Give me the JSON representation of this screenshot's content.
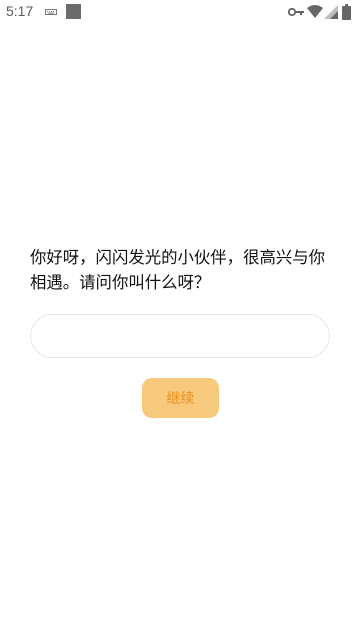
{
  "status_bar": {
    "time": "5:17",
    "icons": [
      "keyboard-icon",
      "notification-square-icon",
      "vpn-key-icon",
      "wifi-icon",
      "cell-signal-icon",
      "battery-icon"
    ]
  },
  "main": {
    "prompt_text": "你好呀，闪闪发光的小伙伴，很高兴与你相遇。请问你叫什么呀？",
    "name_input": {
      "value": "",
      "placeholder": ""
    },
    "continue_label": "继续"
  },
  "colors": {
    "button_bg": "#f7c97c",
    "button_text": "#f0901a",
    "input_border": "#e6e6e6",
    "background": "#ffffff"
  }
}
